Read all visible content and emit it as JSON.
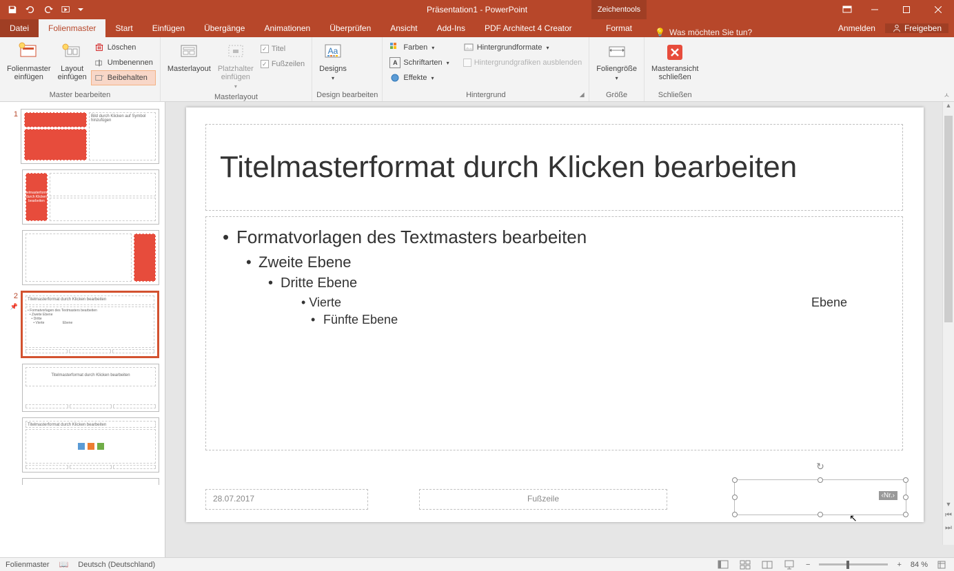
{
  "titlebar": {
    "app_title": "Präsentation1 - PowerPoint",
    "tool_context": "Zeichentools"
  },
  "tabs": {
    "file": "Datei",
    "active": "Folienmaster",
    "items": [
      "Start",
      "Einfügen",
      "Übergänge",
      "Animationen",
      "Überprüfen",
      "Ansicht",
      "Add-Ins",
      "PDF Architect 4 Creator"
    ],
    "format": "Format",
    "tell_me": "Was möchten Sie tun?",
    "sign_in": "Anmelden",
    "share": "Freigeben"
  },
  "ribbon": {
    "group1": {
      "label": "Master bearbeiten",
      "insert_master": "Folienmaster\neinfügen",
      "insert_layout": "Layout\neinfügen",
      "delete": "Löschen",
      "rename": "Umbenennen",
      "preserve": "Beibehalten"
    },
    "group2": {
      "label": "Masterlayout",
      "master_layout": "Masterlayout",
      "insert_placeholder": "Platzhalter\neinfügen",
      "title": "Titel",
      "footers": "Fußzeilen"
    },
    "group3": {
      "label": "Design bearbeiten",
      "designs": "Designs"
    },
    "group4": {
      "label": "Hintergrund",
      "colors": "Farben",
      "fonts": "Schriftarten",
      "effects": "Effekte",
      "bg_formats": "Hintergrundformate",
      "hide_bg": "Hintergrundgrafiken ausblenden"
    },
    "group5": {
      "label": "Größe",
      "slide_size": "Foliengröße"
    },
    "group6": {
      "label": "Schließen",
      "close_master": "Masteransicht\nschließen"
    }
  },
  "slide": {
    "title": "Titelmasterformat durch Klicken bearbeiten",
    "lvl1": "Formatvorlagen des Textmasters bearbeiten",
    "lvl2": "Zweite Ebene",
    "lvl3": "Dritte Ebene",
    "lvl4a": "Vierte",
    "lvl4b": "Ebene",
    "lvl5": "Fünfte Ebene",
    "date": "28.07.2017",
    "footer": "Fußzeile",
    "num": "‹Nr.›"
  },
  "thumbs": {
    "master_num": "1",
    "layout_active_num": "2",
    "t_title": "Titelmasterformat durch Klicken bearbeiten",
    "t_sub": "Formatvorlagen des Textmasters bearbeiten"
  },
  "status": {
    "mode": "Folienmaster",
    "lang": "Deutsch (Deutschland)",
    "zoom": "84 %"
  }
}
